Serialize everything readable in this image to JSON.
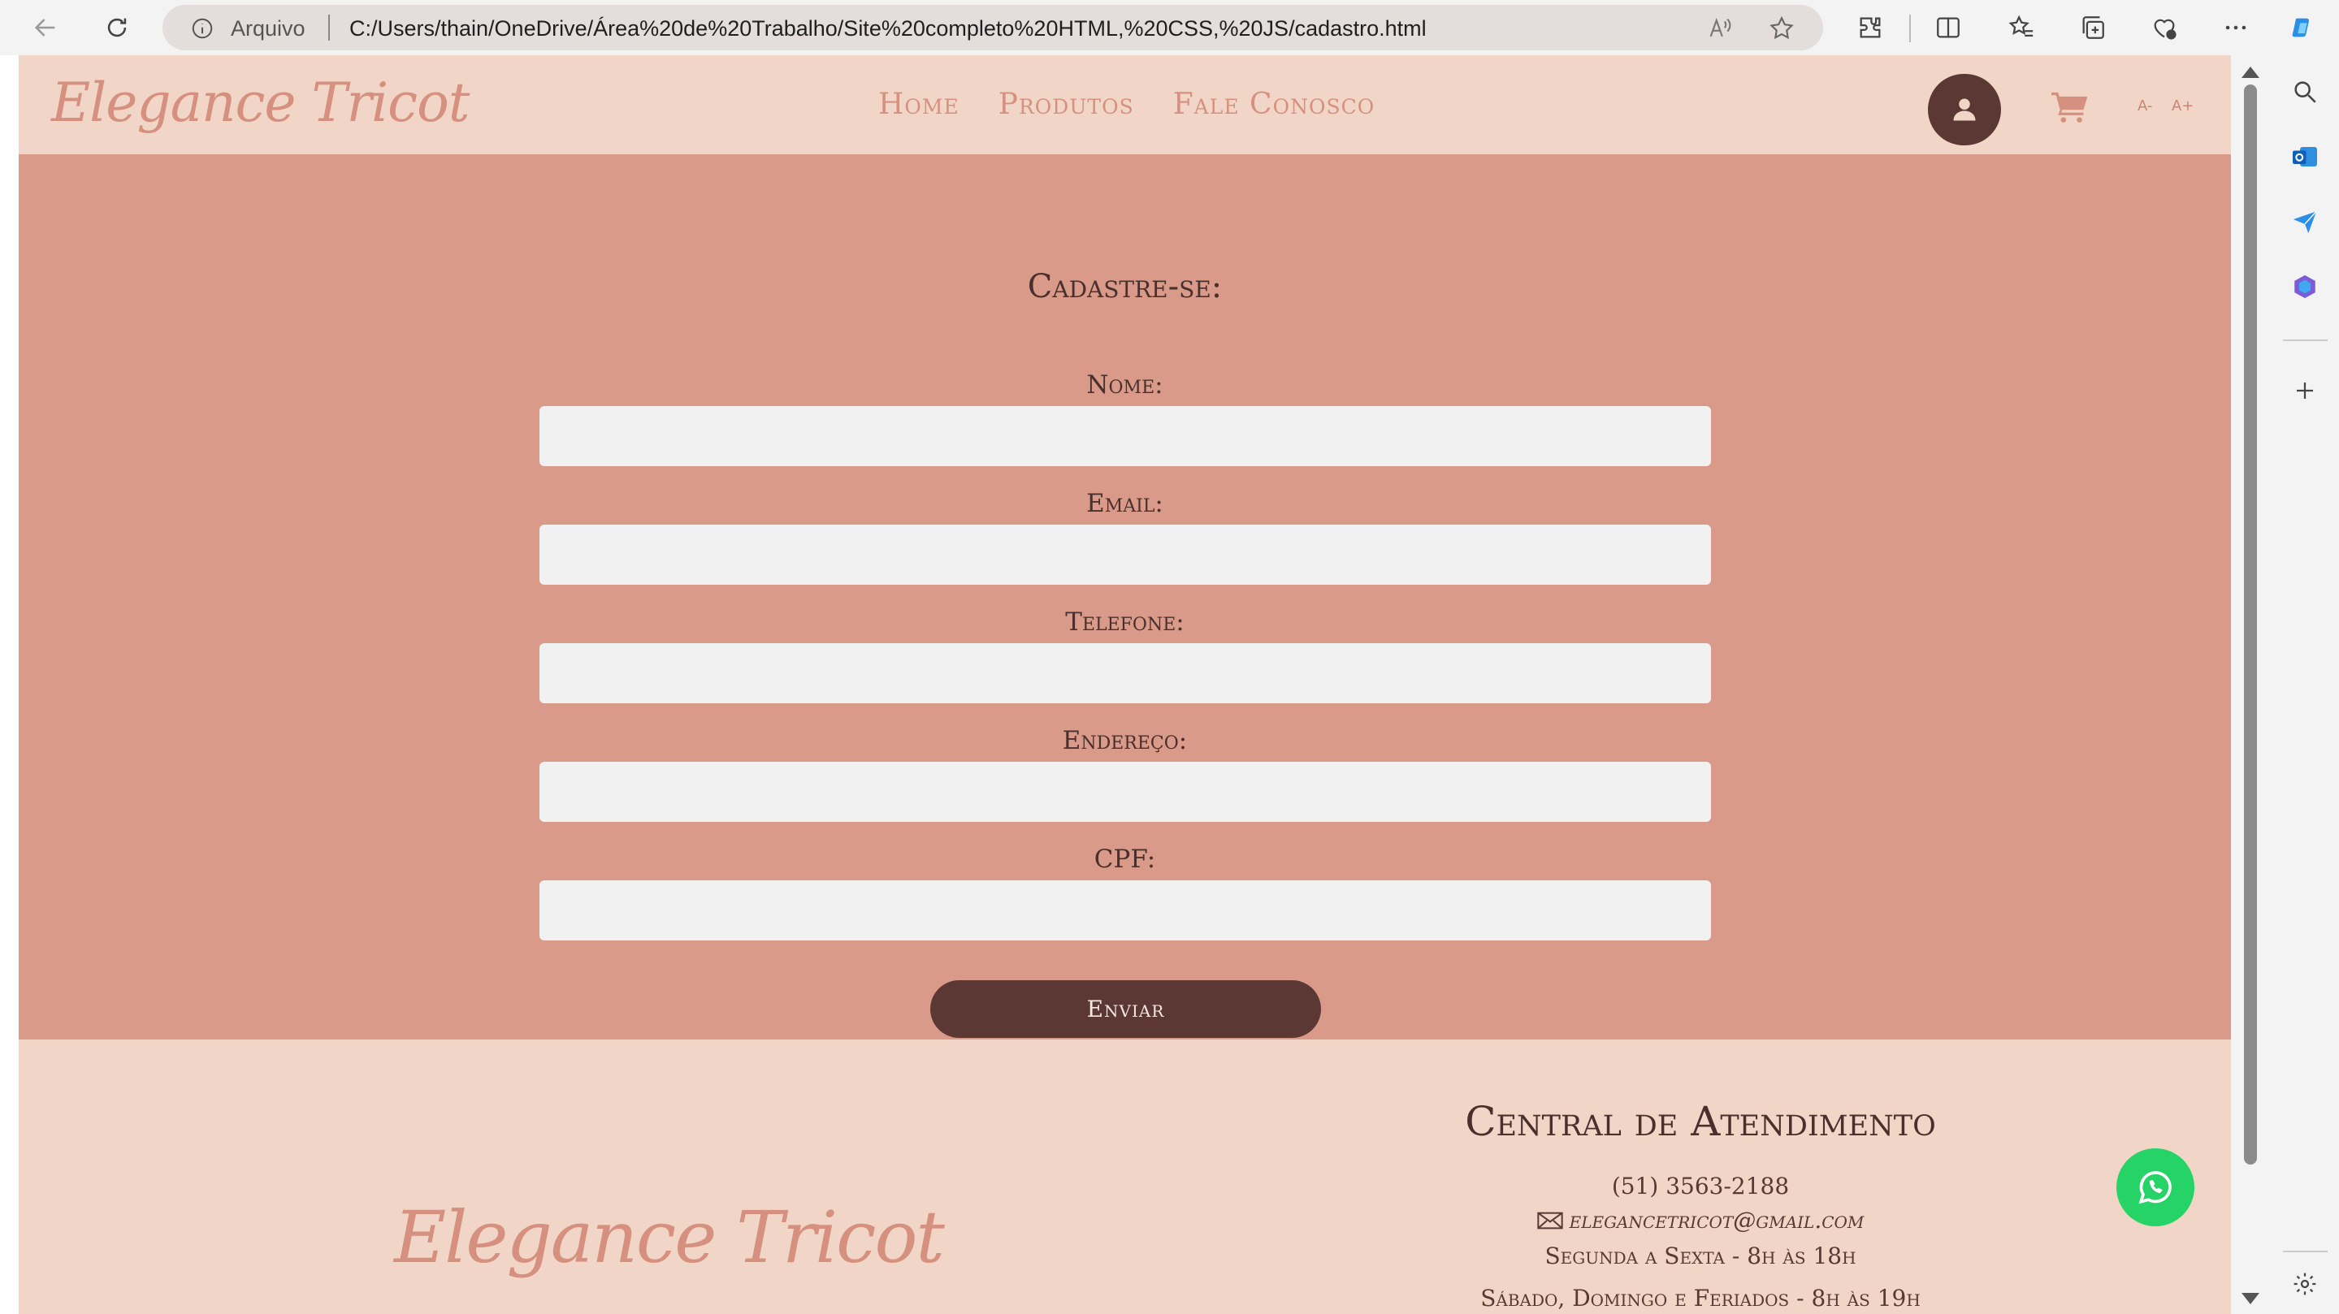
{
  "browser": {
    "address_scheme": "Arquivo",
    "url": "C:/Users/thain/OneDrive/Área%20de%20Trabalho/Site%20completo%20HTML,%20CSS,%20JS/cadastro.html"
  },
  "header": {
    "logo": "Elegance Tricot",
    "nav": [
      "Home",
      "Produtos",
      "Fale Conosco"
    ],
    "font_decrease": "A-",
    "font_increase": "A+"
  },
  "form": {
    "title": "Cadastre-se:",
    "fields": [
      {
        "label": "Nome:",
        "value": ""
      },
      {
        "label": "Email:",
        "value": ""
      },
      {
        "label": "Telefone:",
        "value": ""
      },
      {
        "label": "Endereço:",
        "value": ""
      },
      {
        "label": "CPF:",
        "value": ""
      }
    ],
    "submit_label": "Enviar"
  },
  "footer": {
    "logo": "Elegance Tricot",
    "title": "Central de Atendimento",
    "phone": "(51) 3563-2188",
    "email": "elegancetricot@gmail.com",
    "hours_weekdays": "Segunda a Sexta - 8h às 18h",
    "hours_weekend": "Sábado, Domingo e Feriados - 8h às 19h"
  },
  "colors": {
    "header_bg": "#f1d6c8",
    "form_bg": "#d99a8a",
    "accent_dark": "#5b3833",
    "logo_pink": "#d6907f",
    "whatsapp_green": "#25d366"
  }
}
